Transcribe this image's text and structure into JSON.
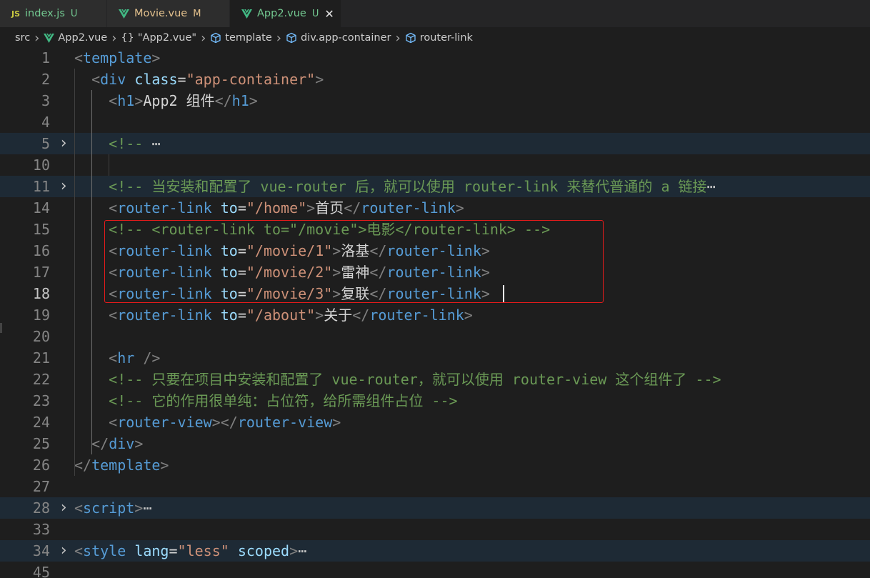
{
  "tabs": [
    {
      "icon": "js-icon",
      "name": "index.js",
      "state": "U",
      "active": false
    },
    {
      "icon": "vue-icon",
      "name": "Movie.vue",
      "state": "M",
      "active": false
    },
    {
      "icon": "vue-icon",
      "name": "App2.vue",
      "state": "U",
      "active": true,
      "close": "✕"
    }
  ],
  "js_icon_text": "JS",
  "breadcrumb": [
    "src",
    "App2.vue",
    "\"App2.vue\"",
    "template",
    "div.app-container",
    "router-link"
  ],
  "breadcrumb_obj_glyph": "{}",
  "colors": {
    "tag": "#569cd6",
    "bracket": "#808080",
    "attr": "#9cdcfe",
    "string": "#ce9178",
    "comment": "#6a9955",
    "text": "#d4d4d4",
    "vue_icon": "#41b883",
    "highlight_box": "#e51b1b",
    "untracked": "#73c991",
    "modified": "#e2c08d"
  },
  "lines": [
    {
      "n": "1",
      "tokens": [
        [
          "b",
          "<"
        ],
        [
          "t",
          "template"
        ],
        [
          "b",
          ">"
        ]
      ]
    },
    {
      "n": "2",
      "tokens": [
        [
          "x",
          "  "
        ],
        [
          "b",
          "<"
        ],
        [
          "t",
          "div"
        ],
        [
          "x",
          " "
        ],
        [
          "a",
          "class"
        ],
        [
          "x",
          "="
        ],
        [
          "s",
          "\"app-container\""
        ],
        [
          "b",
          ">"
        ]
      ]
    },
    {
      "n": "3",
      "tokens": [
        [
          "x",
          "    "
        ],
        [
          "b",
          "<"
        ],
        [
          "t",
          "h1"
        ],
        [
          "b",
          ">"
        ],
        [
          "x",
          "App2 组件"
        ],
        [
          "b",
          "</"
        ],
        [
          "t",
          "h1"
        ],
        [
          "b",
          ">"
        ]
      ]
    },
    {
      "n": "4",
      "tokens": []
    },
    {
      "n": "5",
      "fold": true,
      "hl": true,
      "tokens": [
        [
          "x",
          "    "
        ],
        [
          "c",
          "<!-- "
        ],
        [
          "f",
          "⋯"
        ]
      ]
    },
    {
      "n": "10",
      "tokens": []
    },
    {
      "n": "11",
      "fold": true,
      "hl": true,
      "tokens": [
        [
          "x",
          "    "
        ],
        [
          "c",
          "<!-- 当安装和配置了 vue-router 后，就可以使用 router-link 来替代普通的 a 链接"
        ],
        [
          "f",
          "⋯"
        ]
      ]
    },
    {
      "n": "14",
      "tokens": [
        [
          "x",
          "    "
        ],
        [
          "b",
          "<"
        ],
        [
          "t",
          "router-link"
        ],
        [
          "x",
          " "
        ],
        [
          "a",
          "to"
        ],
        [
          "x",
          "="
        ],
        [
          "s",
          "\"/home\""
        ],
        [
          "b",
          ">"
        ],
        [
          "x",
          "首页"
        ],
        [
          "b",
          "</"
        ],
        [
          "t",
          "router-link"
        ],
        [
          "b",
          ">"
        ]
      ]
    },
    {
      "n": "15",
      "tokens": [
        [
          "x",
          "    "
        ],
        [
          "c",
          "<!-- <router-link to=\"/movie\">电影</router-link> -->"
        ]
      ]
    },
    {
      "n": "16",
      "tokens": [
        [
          "x",
          "    "
        ],
        [
          "b",
          "<"
        ],
        [
          "t",
          "router-link"
        ],
        [
          "x",
          " "
        ],
        [
          "a",
          "to"
        ],
        [
          "x",
          "="
        ],
        [
          "s",
          "\"/movie/1\""
        ],
        [
          "b",
          ">"
        ],
        [
          "x",
          "洛基"
        ],
        [
          "b",
          "</"
        ],
        [
          "t",
          "router-link"
        ],
        [
          "b",
          ">"
        ]
      ]
    },
    {
      "n": "17",
      "tokens": [
        [
          "x",
          "    "
        ],
        [
          "b",
          "<"
        ],
        [
          "t",
          "router-link"
        ],
        [
          "x",
          " "
        ],
        [
          "a",
          "to"
        ],
        [
          "x",
          "="
        ],
        [
          "s",
          "\"/movie/2\""
        ],
        [
          "b",
          ">"
        ],
        [
          "x",
          "雷神"
        ],
        [
          "b",
          "</"
        ],
        [
          "t",
          "router-link"
        ],
        [
          "b",
          ">"
        ]
      ]
    },
    {
      "n": "18",
      "cur": true,
      "tokens": [
        [
          "x",
          "    "
        ],
        [
          "b",
          "<"
        ],
        [
          "t",
          "router-link"
        ],
        [
          "x",
          " "
        ],
        [
          "a",
          "to"
        ],
        [
          "x",
          "="
        ],
        [
          "s",
          "\"/movie/3\""
        ],
        [
          "b",
          ">"
        ],
        [
          "x",
          "复联"
        ],
        [
          "b",
          "</"
        ],
        [
          "t",
          "router-link"
        ],
        [
          "b",
          ">"
        ]
      ]
    },
    {
      "n": "19",
      "tokens": [
        [
          "x",
          "    "
        ],
        [
          "b",
          "<"
        ],
        [
          "t",
          "router-link"
        ],
        [
          "x",
          " "
        ],
        [
          "a",
          "to"
        ],
        [
          "x",
          "="
        ],
        [
          "s",
          "\"/about\""
        ],
        [
          "b",
          ">"
        ],
        [
          "x",
          "关于"
        ],
        [
          "b",
          "</"
        ],
        [
          "t",
          "router-link"
        ],
        [
          "b",
          ">"
        ]
      ]
    },
    {
      "n": "20",
      "tokens": []
    },
    {
      "n": "21",
      "tokens": [
        [
          "x",
          "    "
        ],
        [
          "b",
          "<"
        ],
        [
          "t",
          "hr"
        ],
        [
          "x",
          " "
        ],
        [
          "b",
          "/>"
        ]
      ]
    },
    {
      "n": "22",
      "tokens": [
        [
          "x",
          "    "
        ],
        [
          "c",
          "<!-- 只要在项目中安装和配置了 vue-router，就可以使用 router-view 这个组件了 -->"
        ]
      ]
    },
    {
      "n": "23",
      "tokens": [
        [
          "x",
          "    "
        ],
        [
          "c",
          "<!-- 它的作用很单纯：占位符，给所需组件占位 -->"
        ]
      ]
    },
    {
      "n": "24",
      "tokens": [
        [
          "x",
          "    "
        ],
        [
          "b",
          "<"
        ],
        [
          "t",
          "router-view"
        ],
        [
          "b",
          "></"
        ],
        [
          "t",
          "router-view"
        ],
        [
          "b",
          ">"
        ]
      ]
    },
    {
      "n": "25",
      "tokens": [
        [
          "x",
          "  "
        ],
        [
          "b",
          "</"
        ],
        [
          "t",
          "div"
        ],
        [
          "b",
          ">"
        ]
      ]
    },
    {
      "n": "26",
      "tokens": [
        [
          "b",
          "</"
        ],
        [
          "t",
          "template"
        ],
        [
          "b",
          ">"
        ]
      ]
    },
    {
      "n": "27",
      "tokens": []
    },
    {
      "n": "28",
      "fold": true,
      "hl": true,
      "tokens": [
        [
          "b",
          "<"
        ],
        [
          "t",
          "script"
        ],
        [
          "b",
          ">"
        ],
        [
          "f",
          "⋯"
        ]
      ]
    },
    {
      "n": "33",
      "tokens": []
    },
    {
      "n": "34",
      "fold": true,
      "hl": true,
      "tokens": [
        [
          "b",
          "<"
        ],
        [
          "t",
          "style"
        ],
        [
          "x",
          " "
        ],
        [
          "a",
          "lang"
        ],
        [
          "x",
          "="
        ],
        [
          "s",
          "\"less\""
        ],
        [
          "x",
          " "
        ],
        [
          "a",
          "scoped"
        ],
        [
          "b",
          ">"
        ],
        [
          "f",
          "⋯"
        ]
      ]
    },
    {
      "n": "45",
      "tokens": []
    }
  ]
}
